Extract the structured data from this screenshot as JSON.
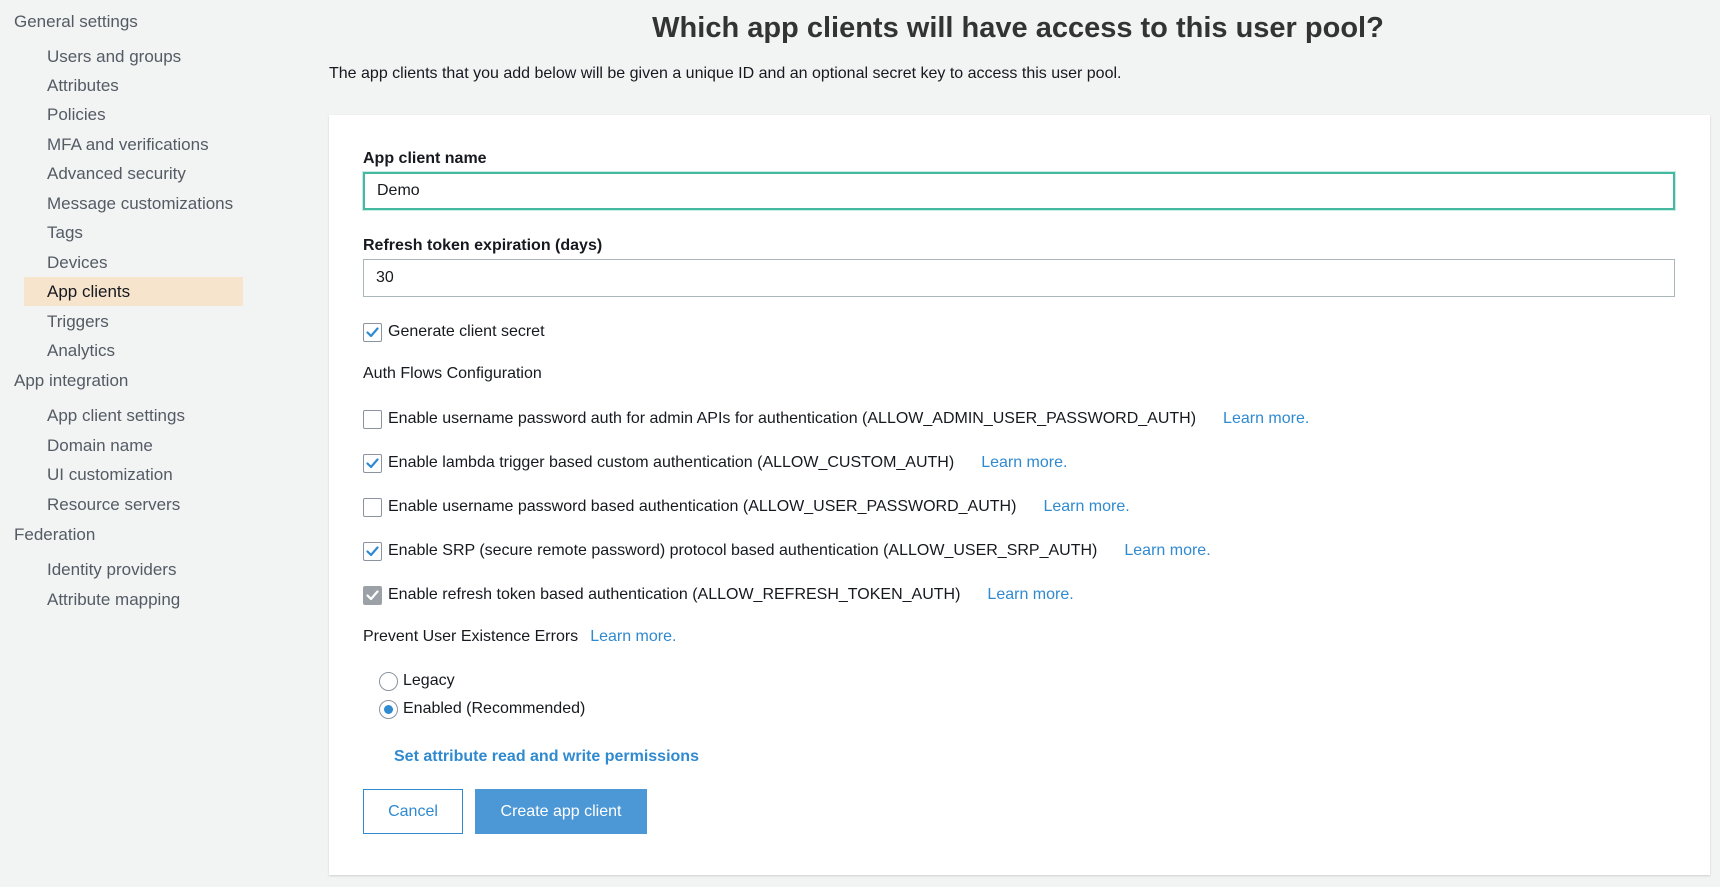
{
  "sidebar": {
    "groups": [
      {
        "label": "General settings",
        "items": [
          {
            "label": "Users and groups"
          },
          {
            "label": "Attributes"
          },
          {
            "label": "Policies"
          },
          {
            "label": "MFA and verifications"
          },
          {
            "label": "Advanced security"
          },
          {
            "label": "Message customizations"
          },
          {
            "label": "Tags"
          },
          {
            "label": "Devices"
          },
          {
            "label": "App clients",
            "active": true
          },
          {
            "label": "Triggers"
          },
          {
            "label": "Analytics"
          }
        ]
      },
      {
        "label": "App integration",
        "items": [
          {
            "label": "App client settings"
          },
          {
            "label": "Domain name"
          },
          {
            "label": "UI customization"
          },
          {
            "label": "Resource servers"
          }
        ]
      },
      {
        "label": "Federation",
        "items": [
          {
            "label": "Identity providers"
          },
          {
            "label": "Attribute mapping"
          }
        ]
      }
    ]
  },
  "header": {
    "title": "Which app clients will have access to this user pool?",
    "description": "The app clients that you add below will be given a unique ID and an optional secret key to access this user pool."
  },
  "form": {
    "client_name": {
      "label": "App client name",
      "value": "Demo"
    },
    "refresh_token": {
      "label": "Refresh token expiration (days)",
      "value": "30"
    },
    "generate_secret": {
      "label": "Generate client secret",
      "checked": true
    },
    "auth_flows": {
      "heading": "Auth Flows Configuration",
      "items": [
        {
          "label": "Enable username password auth for admin APIs for authentication (ALLOW_ADMIN_USER_PASSWORD_AUTH)",
          "checked": false,
          "disabled": false,
          "link": "Learn more."
        },
        {
          "label": "Enable lambda trigger based custom authentication (ALLOW_CUSTOM_AUTH)",
          "checked": true,
          "disabled": false,
          "link": "Learn more."
        },
        {
          "label": "Enable username password based authentication (ALLOW_USER_PASSWORD_AUTH)",
          "checked": false,
          "disabled": false,
          "link": "Learn more."
        },
        {
          "label": "Enable SRP (secure remote password) protocol based authentication (ALLOW_USER_SRP_AUTH)",
          "checked": true,
          "disabled": false,
          "link": "Learn more."
        },
        {
          "label": "Enable refresh token based authentication (ALLOW_REFRESH_TOKEN_AUTH)",
          "checked": true,
          "disabled": true,
          "link": "Learn more."
        }
      ]
    },
    "prevent_errors": {
      "label": "Prevent User Existence Errors",
      "link": "Learn more.",
      "options": [
        {
          "label": "Legacy",
          "selected": false
        },
        {
          "label": "Enabled (Recommended)",
          "selected": true
        }
      ]
    },
    "permissions_link": "Set attribute read and write permissions",
    "cancel_label": "Cancel",
    "create_label": "Create app client"
  },
  "colors": {
    "link": "#2f8ad0",
    "primary_button": "#4c97d6",
    "active_nav": "#f7e4cc",
    "focus_border": "#44b9a0"
  }
}
